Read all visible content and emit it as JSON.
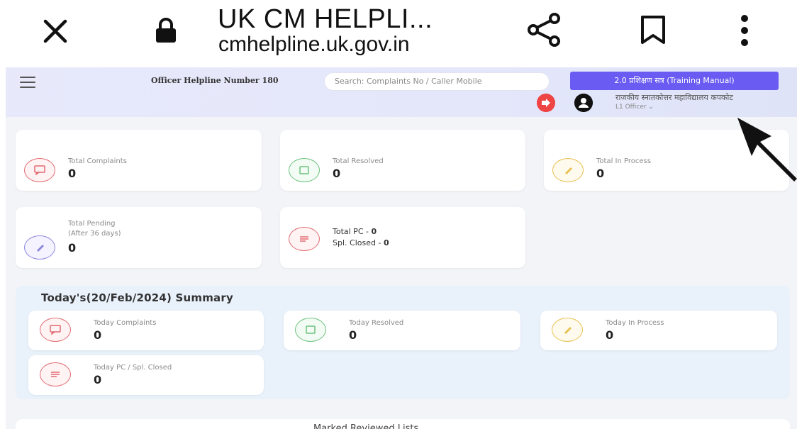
{
  "browser": {
    "title": "UK CM HELPLI...",
    "url": "cmhelpline.uk.gov.in",
    "icons": [
      "close-icon",
      "lock-icon",
      "share-icon",
      "bookmark-icon",
      "more-vertical-icon"
    ]
  },
  "header": {
    "helpline": "Officer Helpline Number 180",
    "search_placeholder": "Search: Complaints No / Caller Mobile",
    "training_button": "2.0 प्रशिक्षण सत्र (Training Manual)",
    "org_name": "राजकीय स्नातकोत्तर महाविद्यालय कपकोट",
    "role": "L1 Officer ⌄"
  },
  "stats": {
    "total_complaints": {
      "label": "Total Complaints",
      "value": "0"
    },
    "total_resolved": {
      "label": "Total Resolved",
      "value": "0"
    },
    "total_in_process": {
      "label": "Total In Process",
      "value": "0"
    },
    "total_pending": {
      "label1": "Total Pending",
      "label2": "(After 36 days)",
      "value": "0"
    },
    "total_pc": {
      "label": "Total PC - ",
      "value": "0",
      "closed_label": "Spl. Closed - ",
      "closed_value": "0"
    }
  },
  "summary": {
    "title": "Today's(20/Feb/2024) Summary",
    "today_complaints": {
      "label": "Today Complaints",
      "value": "0"
    },
    "today_resolved": {
      "label": "Today Resolved",
      "value": "0"
    },
    "today_in_process": {
      "label": "Today In Process",
      "value": "0"
    },
    "today_pc": {
      "label": "Today PC / Spl. Closed",
      "value": "0"
    }
  },
  "bottom": {
    "title": "Marked Reviewed Lists"
  },
  "colors": {
    "accent": "#6a5cf2",
    "red": "#e06b72",
    "green": "#6cc27d",
    "yellow": "#e8c04f",
    "purple": "#8d86e0"
  }
}
